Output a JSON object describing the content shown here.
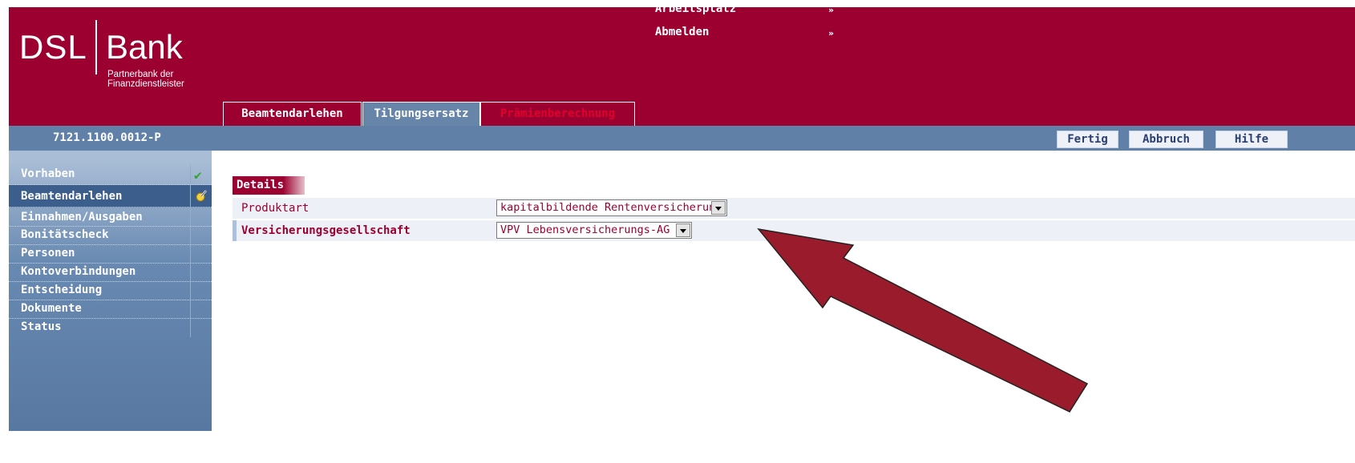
{
  "logo": {
    "brand_left": "DSL",
    "brand_right": "Bank",
    "tagline_line1": "Partnerbank der",
    "tagline_line2": "Finanzdienstleister"
  },
  "top_links": [
    {
      "label": "Arbeitsplatz",
      "arrow": "»"
    },
    {
      "label": "Abmelden",
      "arrow": "»"
    }
  ],
  "tabs": [
    {
      "label": "Beamtendarlehen"
    },
    {
      "label": "Tilgungsersatz"
    },
    {
      "label": "Prämienberechnung"
    }
  ],
  "bar": {
    "contract_no": "7121.1100.0012-P",
    "buttons": {
      "fertig": "Fertig",
      "abbruch": "Abbruch",
      "hilfe": "Hilfe"
    }
  },
  "sidebar": {
    "items": [
      {
        "label": "Vorhaben",
        "status_icon": "check-icon"
      },
      {
        "label": "Beamtendarlehen",
        "status_icon": "pencil-icon"
      },
      {
        "label": "Einnahmen/Ausgaben"
      },
      {
        "label": "Bonitätscheck"
      },
      {
        "label": "Personen"
      },
      {
        "label": "Kontoverbindungen"
      },
      {
        "label": "Entscheidung"
      },
      {
        "label": "Dokumente"
      },
      {
        "label": "Status"
      }
    ]
  },
  "details": {
    "header": "Details",
    "rows": [
      {
        "label": "Produktart",
        "value": "kapitalbildende Rentenversicherung"
      },
      {
        "label": "Versicherungsgesellschaft",
        "value": "VPV Lebensversicherungs-AG"
      }
    ]
  },
  "colors": {
    "brand": "#9c0030",
    "bar": "#6080a8",
    "arrow": "#9a1c2c"
  }
}
